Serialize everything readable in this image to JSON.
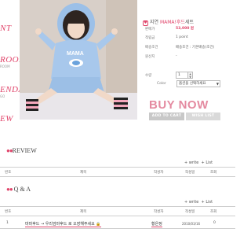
{
  "sidebar": {
    "items": [
      {
        "label": "NT",
        "sub": ""
      },
      {
        "label": "ROOM",
        "sub": "ROOM"
      },
      {
        "label": "ENDANCE",
        "sub": "GO"
      },
      {
        "label": "EW",
        "sub": ""
      }
    ]
  },
  "product": {
    "name_prefix": "지연 ",
    "name_highlight": "MAMA!후드",
    "name_suffix": "세트",
    "price_label": "판매가",
    "price": "53,000 원",
    "points_label": "적립금",
    "points": "1 point",
    "shipping_label": "배송조건",
    "shipping": "배송조건 : 기본배송(조건)",
    "brand_label": "원산지",
    "brand": "-",
    "qty_label": "수량",
    "qty": "1",
    "color_label": "Color",
    "color_option": "옵션을 선택하세요"
  },
  "actions": {
    "buy_now": "BUY NOW",
    "add_to_cart": "ADD TO CART",
    "wish_list": "WISH LIST"
  },
  "review": {
    "title": "REVIEW",
    "write": "+ write",
    "list": "+ List",
    "columns": [
      "번호",
      "제목",
      "작성자",
      "작성일",
      "조회"
    ]
  },
  "qna": {
    "title": "Q & A",
    "write": "+ write",
    "list": "+ List",
    "columns": [
      "번호",
      "제목",
      "작성자",
      "작성일",
      "조회"
    ],
    "rows": [
      {
        "no": "1",
        "subject": "마마후드 → 우리엄마후드 로 오장해주세요 🔒",
        "author": "황은정",
        "date": "2010/03/16",
        "views": "0"
      }
    ]
  }
}
